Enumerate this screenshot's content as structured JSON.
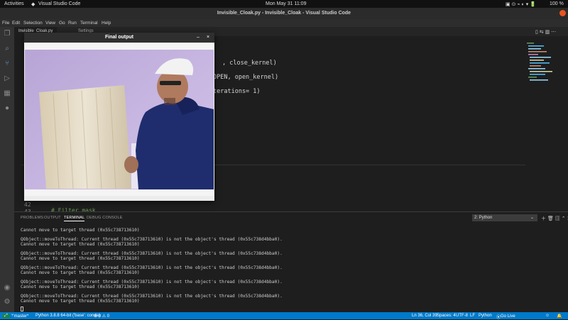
{
  "topbar": {
    "activities": "Activities",
    "app": "Visual Studio Code",
    "clock": "Mon May 31  11:09",
    "battery": "100 %"
  },
  "titlebar": {
    "title": "Invisible_Cloak.py - Invisible_Cloak - Visual Studio Code"
  },
  "menu": [
    "File",
    "Edit",
    "Selection",
    "View",
    "Go",
    "Run",
    "Terminal",
    "Help"
  ],
  "tabs": [
    {
      "label": "Invisible_Cloak.py"
    },
    {
      "label": "Settings"
    }
  ],
  "code_lines": [
    ", close_kernel)",
    "OPEN, open_kernel)",
    "terations= 1)"
  ],
  "line_numbers": [
    "42",
    "43"
  ],
  "code_comment": "# Filter mask",
  "cv_window": {
    "title": "Final output"
  },
  "panel": {
    "tabs": [
      "PROBLEMS",
      "OUTPUT",
      "TERMINAL",
      "DEBUG CONSOLE"
    ],
    "terminal_select": "2: Python",
    "lines": [
      "Cannot move to target thread (0x55c738713610)",
      "",
      "QObject::moveToThread: Current thread (0x55c738713610) is not the object's thread (0x55c738d4bba0).",
      "Cannot move to target thread (0x55c738713610)",
      "",
      "QObject::moveToThread: Current thread (0x55c738713610) is not the object's thread (0x55c738d4bba0).",
      "Cannot move to target thread (0x55c738713610)",
      "",
      "QObject::moveToThread: Current thread (0x55c738713610) is not the object's thread (0x55c738d4bba0).",
      "Cannot move to target thread (0x55c738713610)",
      "",
      "QObject::moveToThread: Current thread (0x55c738713610) is not the object's thread (0x55c738d4bba0).",
      "Cannot move to target thread (0x55c738713610)",
      "",
      "QObject::moveToThread: Current thread (0x55c738713610) is not the object's thread (0x55c738d4bba0).",
      "Cannot move to target thread (0x55c738713610)"
    ]
  },
  "statusbar": {
    "branch": "master*",
    "interpreter": "Python 3.8.8 64-bit ('base': conda)",
    "problems": "⊗ 0 ⚠ 0",
    "position": "Ln 36, Col 39",
    "spaces": "Spaces: 4",
    "encoding": "UTF-8",
    "eol": "LF",
    "language": "Python",
    "golive": "Go Live"
  },
  "colors": {
    "statusbar": "#007acc",
    "editor_bg": "#1e1e1e"
  }
}
